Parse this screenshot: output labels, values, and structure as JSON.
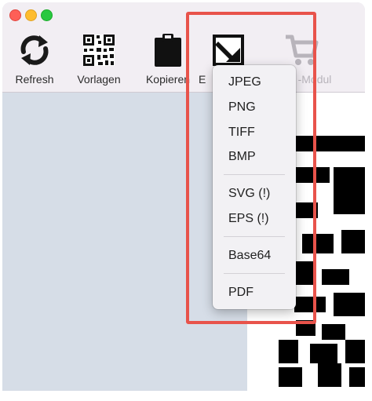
{
  "toolbar": {
    "items": [
      {
        "label": "Refresh",
        "icon": "refresh-icon"
      },
      {
        "label": "Vorlagen",
        "icon": "qr-code-icon"
      },
      {
        "label": "Kopieren",
        "icon": "clipboard-icon"
      },
      {
        "label": "E",
        "icon": "export-icon"
      },
      {
        "label": "-Modul",
        "icon": "cart-icon"
      }
    ]
  },
  "export_menu": {
    "items": [
      "JPEG",
      "PNG",
      "TIFF",
      "BMP",
      "SVG (!)",
      "EPS (!)",
      "Base64",
      "PDF"
    ]
  },
  "colors": {
    "highlight": "#e8534b",
    "toolbar_bg": "#f2eef3",
    "canvas_bg": "#d6dde7"
  }
}
